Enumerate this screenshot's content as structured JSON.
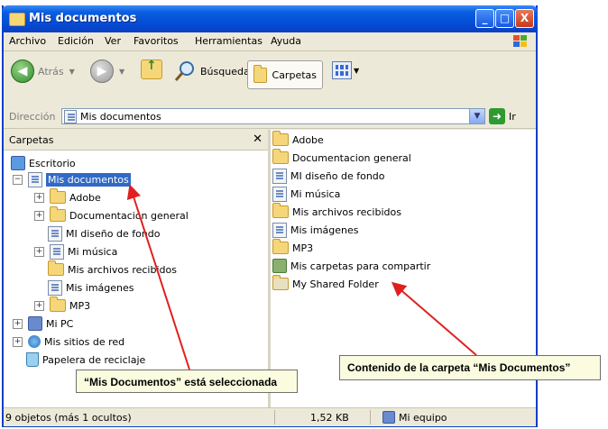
{
  "window": {
    "title": "Mis documentos",
    "min_label": "_",
    "max_label": "□",
    "close_label": "X"
  },
  "menu": [
    "Archivo",
    "Edición",
    "Ver",
    "Favoritos",
    "Herramientas",
    "Ayuda"
  ],
  "toolbar": {
    "back": "Atrás",
    "search": "Búsqueda",
    "folders": "Carpetas"
  },
  "address": {
    "label": "Dirección",
    "value": "Mis documentos",
    "go": "Ir"
  },
  "left_pane": {
    "title": "Carpetas",
    "tree": [
      {
        "label": "Escritorio"
      },
      {
        "label": "Mis documentos"
      },
      {
        "label": "Adobe"
      },
      {
        "label": "Documentacion general"
      },
      {
        "label": "MI diseño de fondo"
      },
      {
        "label": "Mi música"
      },
      {
        "label": "Mis archivos recibidos"
      },
      {
        "label": "Mis imágenes"
      },
      {
        "label": "MP3"
      },
      {
        "label": "Mi PC"
      },
      {
        "label": "Mis sitios de red"
      },
      {
        "label": "Papelera de reciclaje"
      }
    ]
  },
  "right_pane": {
    "items": [
      {
        "label": "Adobe"
      },
      {
        "label": "Documentacion general"
      },
      {
        "label": "MI diseño de fondo"
      },
      {
        "label": "Mi música"
      },
      {
        "label": "Mis archivos recibidos"
      },
      {
        "label": "Mis imágenes"
      },
      {
        "label": "MP3"
      },
      {
        "label": "Mis carpetas para compartir"
      },
      {
        "label": "My Shared Folder"
      }
    ]
  },
  "status": {
    "objects": "9 objetos (más 1 ocultos)",
    "size": "1,52 KB",
    "location": "Mi equipo"
  },
  "callouts": {
    "selected": "“Mis Documentos” está seleccionada",
    "contents": "Contenido de la carpeta “Mis Documentos”"
  },
  "colors": {
    "title_bar": "#0a5ee0",
    "selection": "#316ac5",
    "arrow": "#e02020",
    "callout_bg": "#fbfbe0"
  }
}
